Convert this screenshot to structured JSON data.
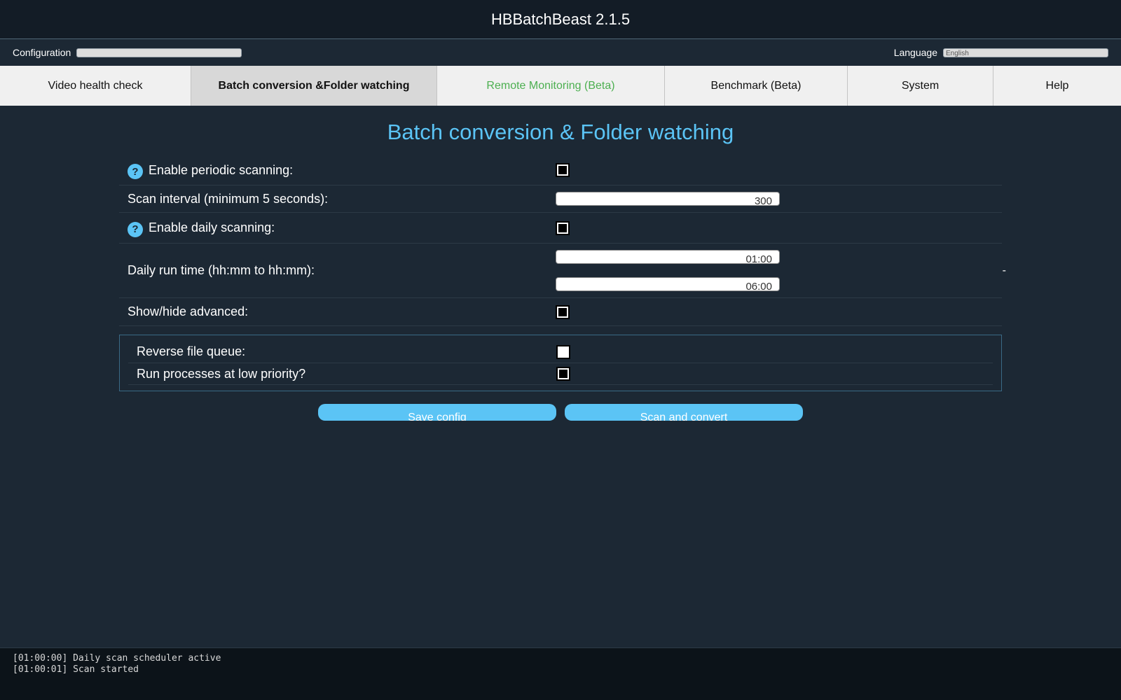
{
  "app": {
    "title": "HBBatchBeast 2.1.5"
  },
  "config_bar": {
    "configuration_label": "Configuration",
    "configuration_value": "",
    "language_label": "Language",
    "language_value": "English"
  },
  "tabs": [
    {
      "label": "Video health check",
      "active": false
    },
    {
      "label": "Batch conversion &Folder watching",
      "active": true
    },
    {
      "label": "Remote Monitoring (Beta)",
      "active": false,
      "color": "#4caf50"
    },
    {
      "label": "Benchmark (Beta)",
      "active": false
    },
    {
      "label": "System",
      "active": false
    },
    {
      "label": "Help",
      "active": false
    }
  ],
  "page": {
    "title": "Batch conversion & Folder watching",
    "help_icon_glyph": "?",
    "periodic_scanning": {
      "label": "Enable periodic scanning:",
      "checked": true
    },
    "scan_interval": {
      "label": "Scan interval (minimum 5 seconds):",
      "value": "300"
    },
    "daily_scanning": {
      "label": "Enable daily scanning:",
      "checked": true
    },
    "daily_run_time": {
      "label": "Daily run time (hh:mm to hh:mm):",
      "start": "01:00",
      "end": "06:00",
      "separator": "-"
    },
    "show_advanced": {
      "label": "Show/hide advanced:",
      "checked": true
    },
    "advanced": {
      "reverse_queue": {
        "label": "Reverse file queue:",
        "checked": false
      },
      "low_priority": {
        "label": "Run processes at low priority?",
        "checked": true
      }
    }
  },
  "buttons": {
    "save_label": "Save config",
    "scan_label": "Scan and convert"
  },
  "log": {
    "lines": [
      "[01:00:00] Daily scan scheduler active",
      "[01:00:01] Scan started"
    ]
  },
  "colors": {
    "accent": "#5bc4f5",
    "background": "#1c2834",
    "header": "#131c26",
    "tab_green": "#4caf50"
  }
}
